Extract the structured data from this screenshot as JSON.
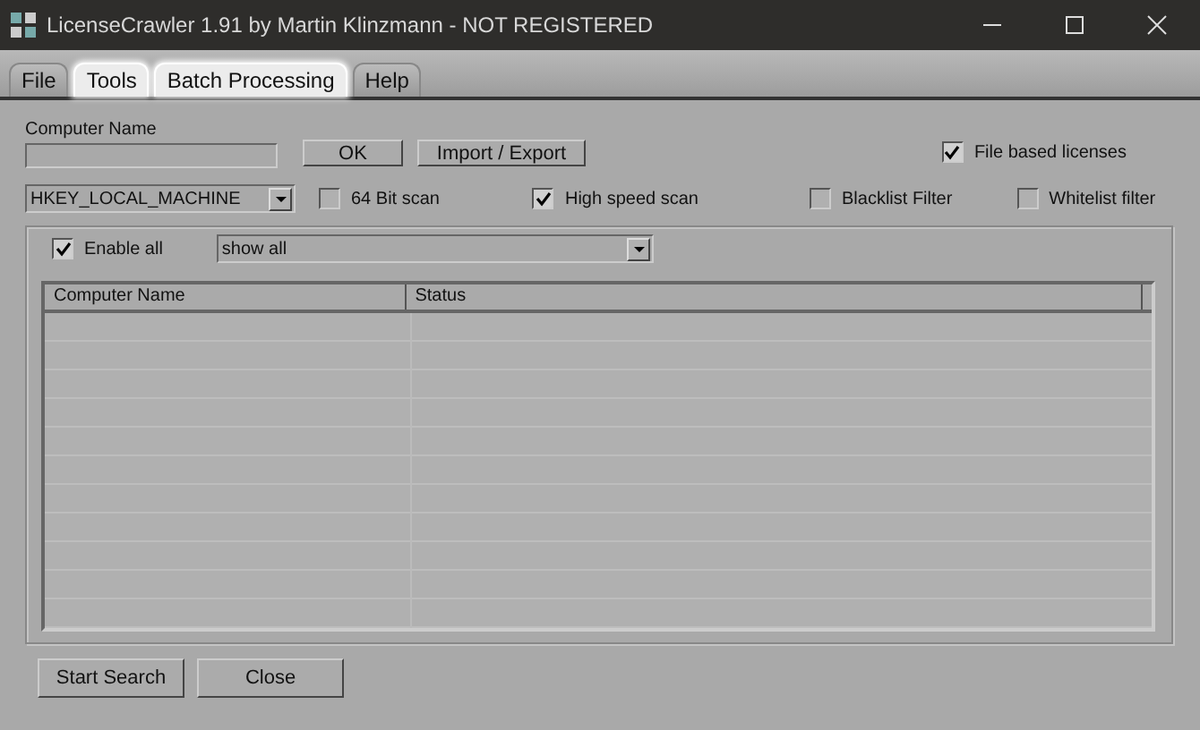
{
  "window": {
    "title": "LicenseCrawler 1.91 by Martin Klinzmann - NOT REGISTERED"
  },
  "tabs": [
    {
      "label": "File",
      "highlighted": false
    },
    {
      "label": "Tools",
      "highlighted": true
    },
    {
      "label": "Batch Processing",
      "highlighted": true
    },
    {
      "label": "Help",
      "highlighted": false
    }
  ],
  "computer_name": {
    "label": "Computer Name"
  },
  "buttons": [
    "OK",
    "Import / Export"
  ],
  "registry_hive": {
    "value": "HKEY_LOCAL_MACHINE"
  },
  "options": [
    {
      "label": "64 Bit scan",
      "checked": false
    },
    {
      "label": "High speed scan",
      "checked": true
    },
    {
      "label": "Blacklist Filter",
      "checked": false
    },
    {
      "label": "Whitelist filter",
      "checked": false
    }
  ],
  "file_based_licenses": {
    "label": "File based licenses",
    "checked": true
  },
  "enable_all": {
    "label": "Enable all",
    "checked": true
  },
  "filter": {
    "value": "show all"
  },
  "table": {
    "columns": [
      "Computer Name",
      "Status"
    ]
  },
  "footer_buttons": [
    "Start Search",
    "Close"
  ]
}
